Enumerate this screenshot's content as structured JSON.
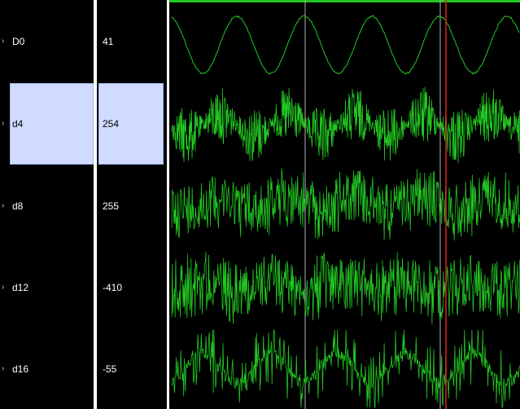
{
  "channels": [
    {
      "name": "D0",
      "value": "41"
    },
    {
      "name": "d4",
      "value": "254"
    },
    {
      "name": "d8",
      "value": "255"
    },
    {
      "name": "d12",
      "value": "-410"
    },
    {
      "name": "d16",
      "value": "-55"
    }
  ],
  "selected_channel_index": 1,
  "colors": {
    "waveform": "#22c822",
    "cursor_marker": "#e02020",
    "cursor_lines": "#b4b4b4",
    "selection": "#cfdcff"
  },
  "icons": {
    "expand": "chevron-right-icon"
  }
}
